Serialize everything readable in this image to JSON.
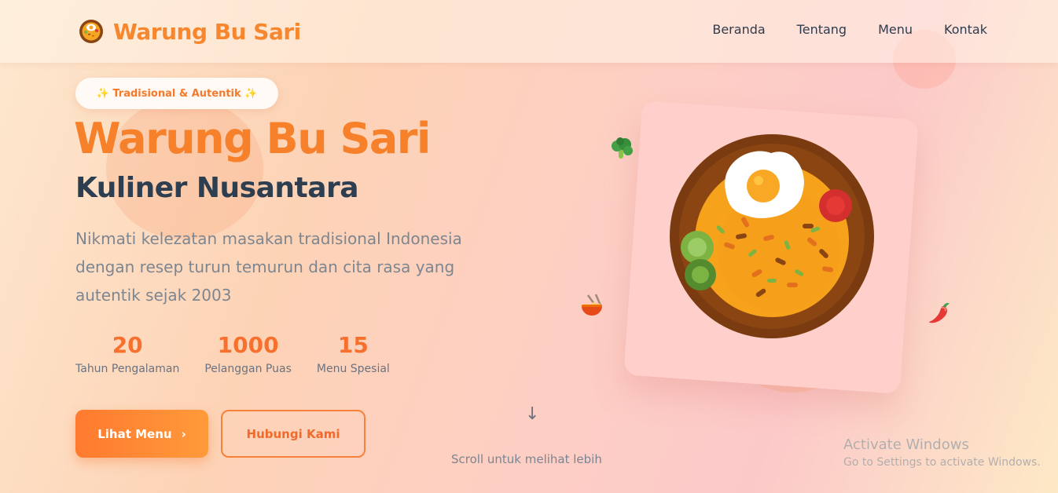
{
  "brand": {
    "name": "Warung Bu Sari",
    "logo_icon": "food-bowl-icon"
  },
  "nav": {
    "items": [
      "Beranda",
      "Tentang",
      "Menu",
      "Kontak"
    ]
  },
  "hero": {
    "badge": "✨ Tradisional & Autentik ✨",
    "title": "Warung Bu Sari",
    "subtitle": "Kuliner Nusantara",
    "description": "Nikmati kelezatan masakan tradisional Indonesia dengan resep turun temurun dan cita rasa yang autentik sejak 2003",
    "stats": [
      {
        "value": "20",
        "label": "Tahun Pengalaman"
      },
      {
        "value": "1000",
        "label": "Pelanggan Puas"
      },
      {
        "value": "15",
        "label": "Menu Spesial"
      }
    ],
    "primary_button": "Lihat Menu",
    "primary_button_icon": "›",
    "secondary_button": "Hubungi Kami"
  },
  "scroll": {
    "arrow": "↓",
    "text": "Scroll untuk melihat lebih"
  },
  "illustration": {
    "main": "fried-rice-plate-icon",
    "floating": [
      "broccoli-icon",
      "noodle-bowl-icon",
      "chili-icon"
    ]
  },
  "watermark": {
    "title": "Activate Windows",
    "subtitle": "Go to Settings to activate Windows."
  },
  "colors": {
    "accent": "#f7812a",
    "dark_text": "#2c3e50",
    "muted_text": "#7d8690"
  }
}
